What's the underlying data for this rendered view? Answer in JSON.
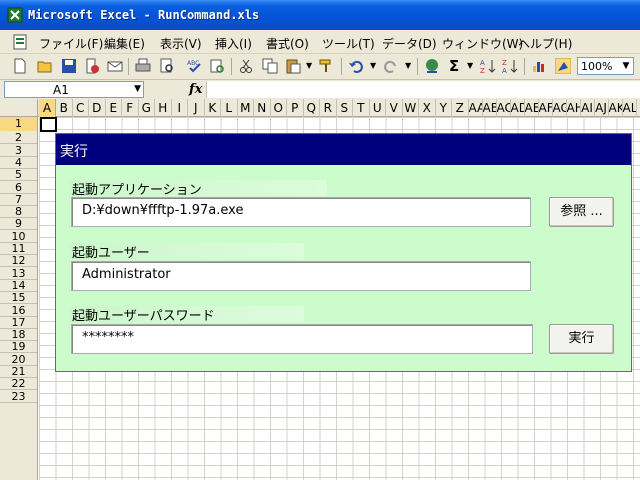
{
  "window": {
    "title": "Microsoft Excel - RunCommand.xls"
  },
  "menu": [
    "ファイル(F)",
    "編集(E)",
    "表示(V)",
    "挿入(I)",
    "書式(O)",
    "ツール(T)",
    "データ(D)",
    "ウィンドウ(W)",
    "ヘルプ(H)"
  ],
  "toolbar": {
    "zoom": "100%"
  },
  "formula_bar": {
    "name_box": "A1",
    "fx": "fx",
    "formula": ""
  },
  "columns": [
    "A",
    "B",
    "C",
    "D",
    "E",
    "F",
    "G",
    "H",
    "I",
    "J",
    "K",
    "L",
    "M",
    "N",
    "O",
    "P",
    "Q",
    "R",
    "S",
    "T",
    "U",
    "V",
    "W",
    "X",
    "Y",
    "Z",
    "AA",
    "AB",
    "AC",
    "AD",
    "AE",
    "AF",
    "AG",
    "AH",
    "AI",
    "AJ",
    "AK",
    "AL"
  ],
  "rows": [
    "1",
    "2",
    "3",
    "4",
    "5",
    "6",
    "7",
    "8",
    "9",
    "10",
    "11",
    "12",
    "13",
    "14",
    "15",
    "16",
    "17",
    "18",
    "19",
    "20",
    "21",
    "22",
    "23"
  ],
  "form": {
    "header": "実行",
    "app_label": "起動アプリケーション",
    "app_value": "D:¥down¥ffftp-1.97a.exe",
    "browse_button": "参照 ...",
    "user_label": "起動ユーザー",
    "user_value": "Administrator",
    "password_label": "起動ユーザーパスワード",
    "password_value": "********",
    "run_button": "実行"
  },
  "colors": {
    "title_bar": "#0553d6",
    "form_bg": "#ccfccc",
    "form_header": "#00007f",
    "selection": "#f9d882"
  }
}
